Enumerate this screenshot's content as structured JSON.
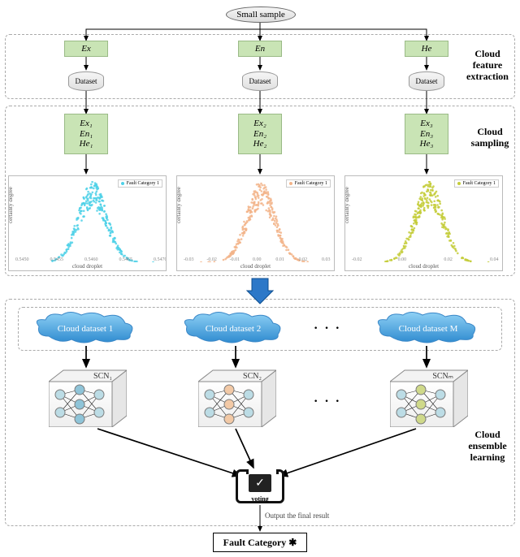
{
  "top": {
    "small_sample": "Small sample"
  },
  "features": {
    "ex": "Ex",
    "en": "En",
    "he": "He",
    "dataset": "Dataset"
  },
  "sampling": {
    "c1": {
      "l1": "Ex₁",
      "l2": "En₁",
      "l3": "He₁"
    },
    "c2": {
      "l1": "Ex₂",
      "l2": "En₂",
      "l3": "He₂"
    },
    "c3": {
      "l1": "Ex₃",
      "l2": "En₃",
      "l3": "He₃"
    }
  },
  "charts": {
    "ylabel": "certainty degree",
    "xlabel": "cloud droplet",
    "legend": "Fault Category 1",
    "colors": {
      "c1": "#4fd1e8",
      "c2": "#f2b48a",
      "c3": "#c4cc3a"
    },
    "xticks": {
      "c1": [
        "0.5450",
        "0.5455",
        "0.5460",
        "0.5465",
        "0.5470"
      ],
      "c2": [
        "-0.03",
        "-0.02",
        "-0.01",
        "0.00",
        "0.01",
        "0.02",
        "0.03"
      ],
      "c3": [
        "-0.02",
        "0.00",
        "0.02",
        "0.04"
      ]
    }
  },
  "clouds": {
    "c1": "Cloud dataset 1",
    "c2": "Cloud dataset 2",
    "cm": "Cloud dataset M"
  },
  "scn": {
    "s1": "SCN₁",
    "s2": "SCN₂",
    "sm": "SCNₘ"
  },
  "voting": "voting",
  "output_line": "Output the final result",
  "final": "Fault Category ✱",
  "side": {
    "feature": "Cloud feature extraction",
    "sampling": "Cloud sampling",
    "ensemble": "Cloud ensemble learning"
  },
  "ellipsis": "· · ·"
}
